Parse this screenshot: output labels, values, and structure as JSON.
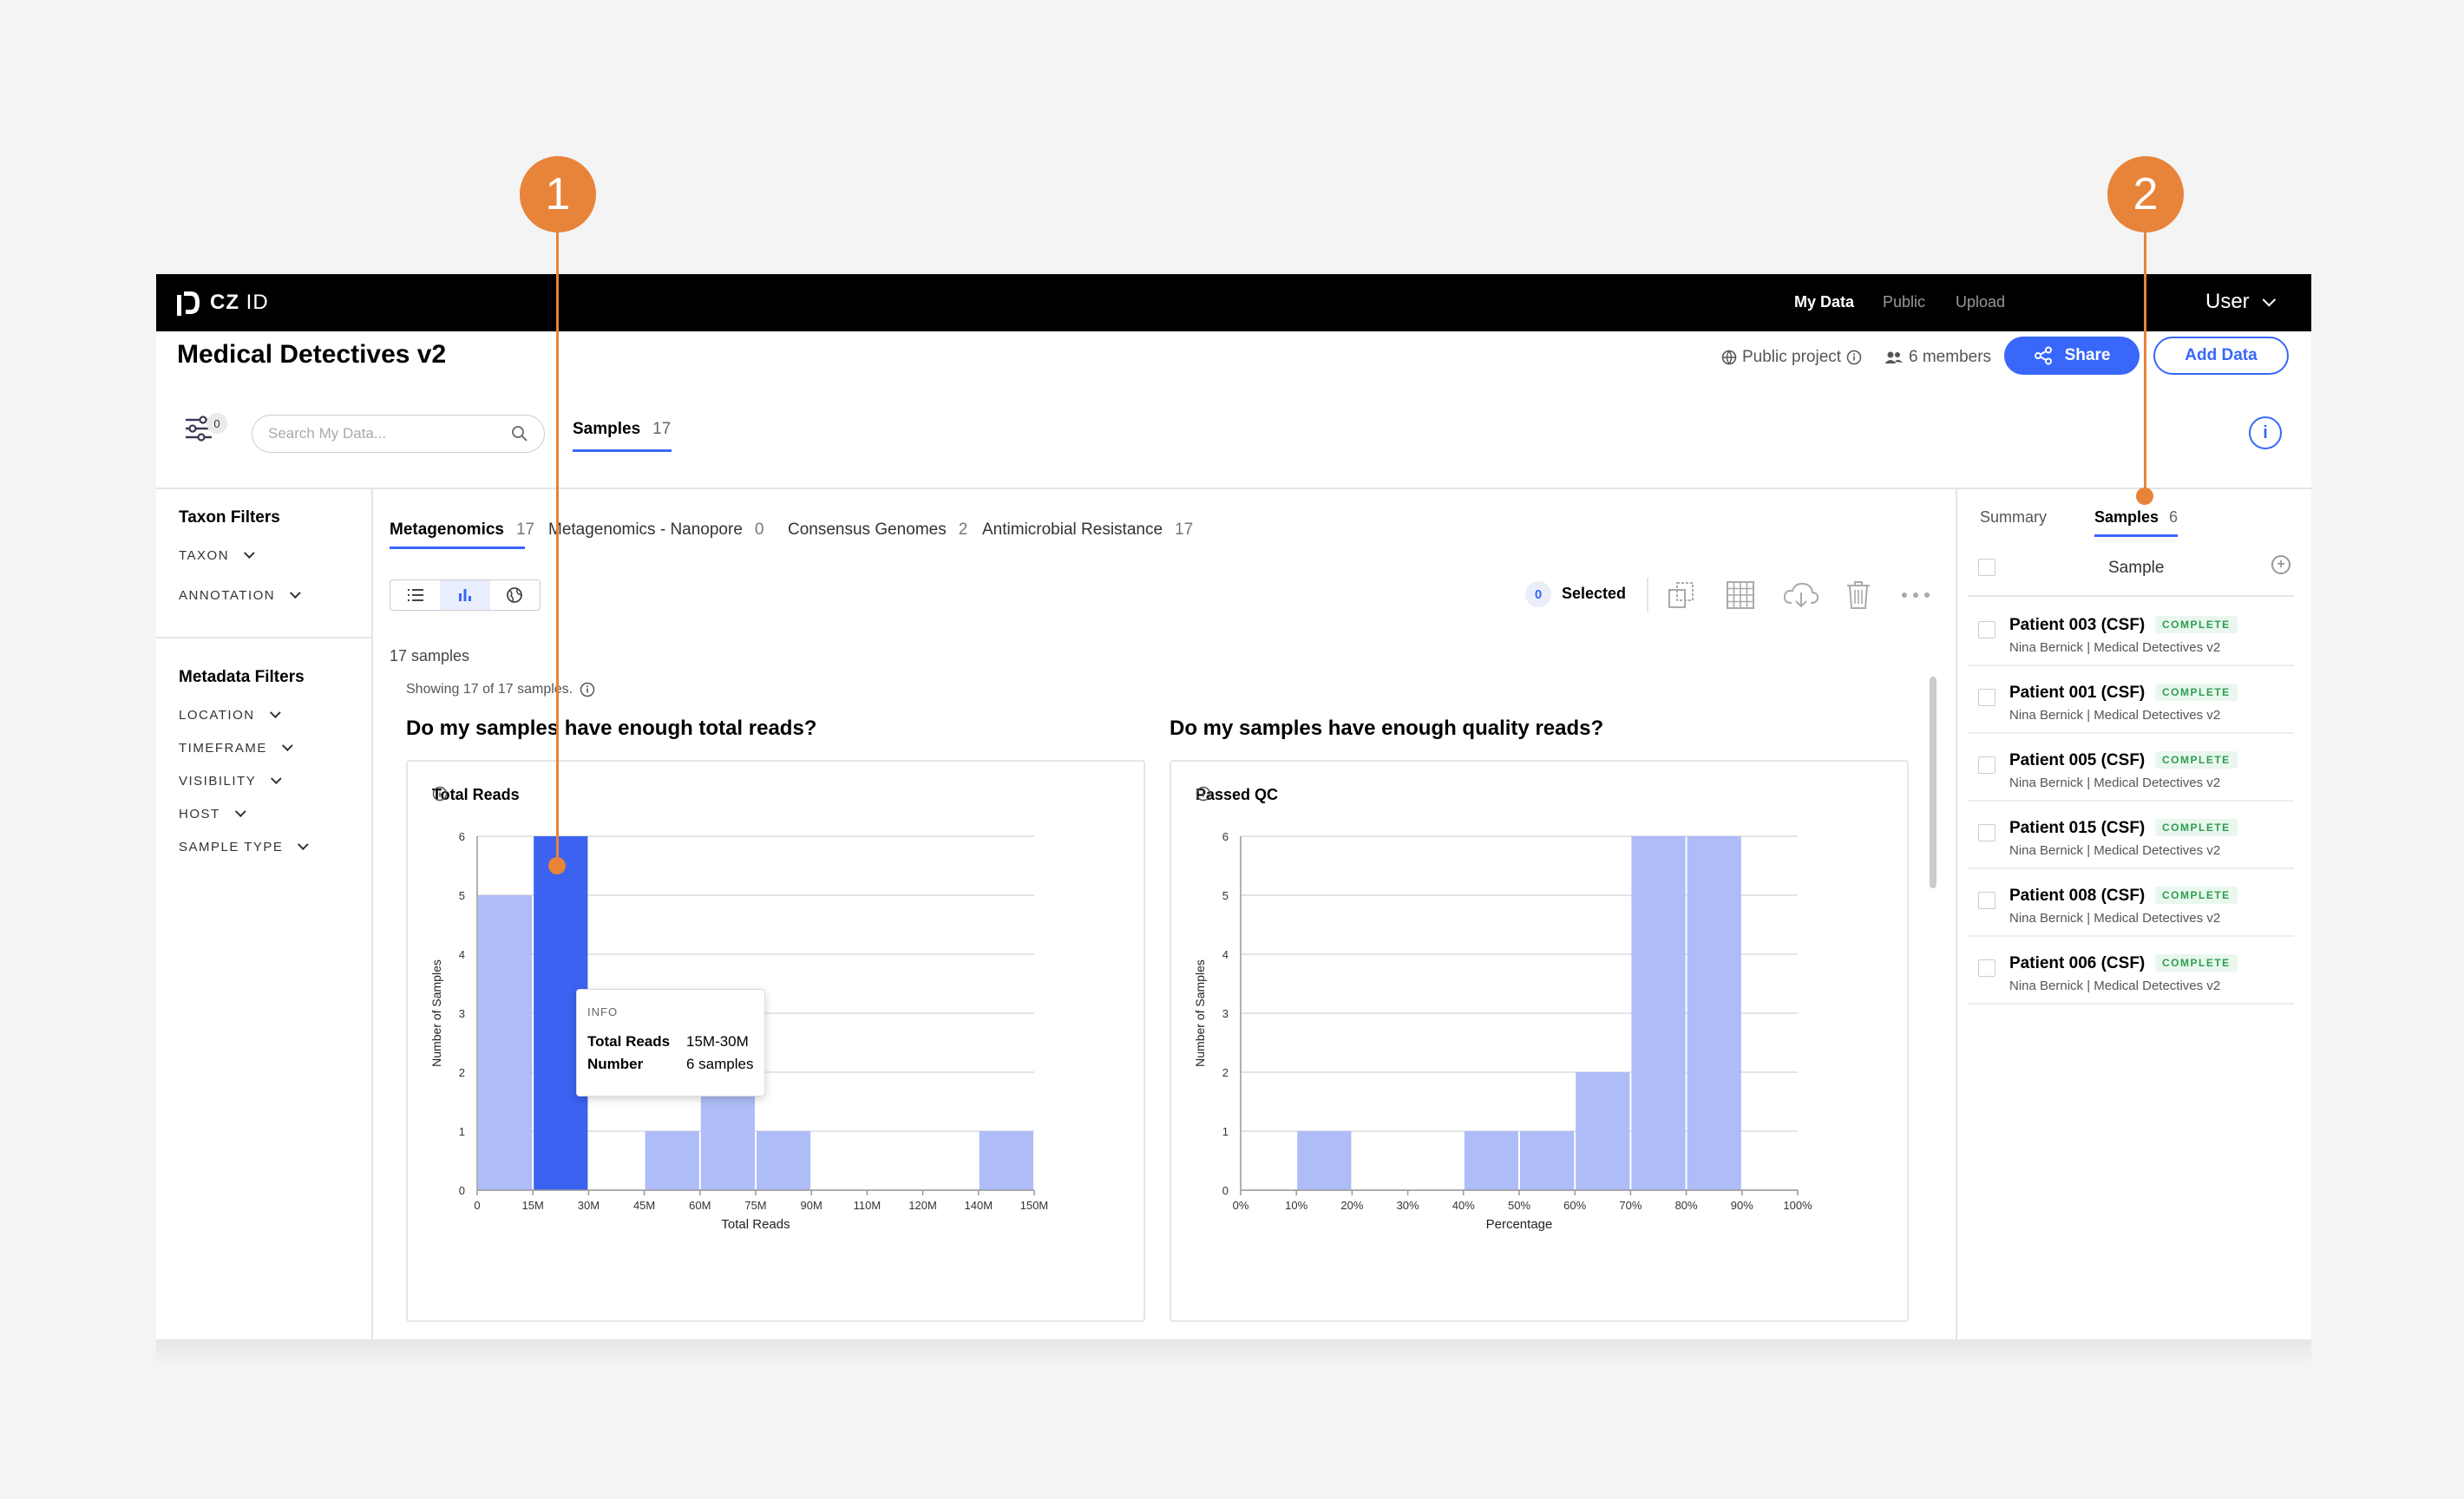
{
  "app": {
    "brand": "CZ",
    "brand_suffix": "ID",
    "nav": [
      "My Data",
      "Public",
      "Upload"
    ],
    "user": "User"
  },
  "project": {
    "title": "Medical Detectives v2",
    "visibility": "Public project",
    "members": "6 members",
    "share_label": "Share",
    "add_data_label": "Add Data"
  },
  "toolbar": {
    "filter_count": "0",
    "search_placeholder": "Search My Data...",
    "tab_label": "Samples",
    "tab_count": "17"
  },
  "sidebar": {
    "taxon_heading": "Taxon Filters",
    "taxon_items": [
      "TAXON",
      "ANNOTATION"
    ],
    "metadata_heading": "Metadata Filters",
    "metadata_items": [
      "LOCATION",
      "TIMEFRAME",
      "VISIBILITY",
      "HOST",
      "SAMPLE TYPE"
    ]
  },
  "workflow_tabs": [
    {
      "label": "Metagenomics",
      "count": "17"
    },
    {
      "label": "Metagenomics - Nanopore",
      "count": "0"
    },
    {
      "label": "Consensus Genomes",
      "count": "2"
    },
    {
      "label": "Antimicrobial Resistance",
      "count": "17"
    }
  ],
  "selection": {
    "count": "0",
    "label": "Selected"
  },
  "summary": {
    "samples_text": "17 samples",
    "showing_text": "Showing 17 of 17 samples."
  },
  "charts": {
    "q1": "Do my samples have enough total reads?",
    "q2": "Do my samples have enough quality reads?",
    "card1_title": "Total Reads",
    "card2_title": "Passed QC"
  },
  "tooltip": {
    "header": "INFO",
    "row1_key": "Total Reads",
    "row1_val": "15M-30M",
    "row2_key": "Number",
    "row2_val": "6 samples"
  },
  "right_panel": {
    "tab_summary": "Summary",
    "tab_samples": "Samples",
    "tab_samples_count": "6",
    "column_header": "Sample",
    "samples": [
      {
        "name": "Patient 003 (CSF)",
        "status": "COMPLETE",
        "sub": "Nina Bernick | Medical Detectives v2"
      },
      {
        "name": "Patient 001 (CSF)",
        "status": "COMPLETE",
        "sub": "Nina Bernick | Medical Detectives v2"
      },
      {
        "name": "Patient 005 (CSF)",
        "status": "COMPLETE",
        "sub": "Nina Bernick | Medical Detectives v2"
      },
      {
        "name": "Patient 015 (CSF)",
        "status": "COMPLETE",
        "sub": "Nina Bernick | Medical Detectives v2"
      },
      {
        "name": "Patient 008 (CSF)",
        "status": "COMPLETE",
        "sub": "Nina Bernick | Medical Detectives v2"
      },
      {
        "name": "Patient 006 (CSF)",
        "status": "COMPLETE",
        "sub": "Nina Bernick | Medical Detectives v2"
      }
    ]
  },
  "callouts": [
    "1",
    "2"
  ],
  "colors": {
    "accent": "#3867fa",
    "bar": "#aebcf7",
    "bar_highlight": "#3b62f0",
    "callout": "#e8833a",
    "complete": "#2e9e4f"
  },
  "chart_data": [
    {
      "type": "bar",
      "title": "Total Reads",
      "xlabel": "Total Reads",
      "ylabel": "Number of Samples",
      "x_ticks": [
        "0",
        "15M",
        "30M",
        "45M",
        "60M",
        "75M",
        "90M",
        "110M",
        "120M",
        "140M",
        "150M"
      ],
      "bins": [
        [
          0,
          15
        ],
        [
          15,
          30
        ],
        [
          30,
          45
        ],
        [
          45,
          60
        ],
        [
          60,
          75
        ],
        [
          75,
          90
        ],
        [
          90,
          105
        ],
        [
          105,
          120
        ],
        [
          120,
          135
        ],
        [
          135,
          150
        ]
      ],
      "values": [
        5,
        6,
        0,
        1,
        2,
        1,
        0,
        0,
        0,
        1
      ],
      "highlight_index": 1,
      "ylim": [
        0,
        6
      ],
      "y_ticks": [
        0,
        1,
        2,
        3,
        4,
        5,
        6
      ]
    },
    {
      "type": "bar",
      "title": "Passed QC",
      "xlabel": "Percentage",
      "ylabel": "Number of Samples",
      "x_ticks": [
        "0%",
        "10%",
        "20%",
        "30%",
        "40%",
        "50%",
        "60%",
        "70%",
        "80%",
        "90%",
        "100%"
      ],
      "bins": [
        [
          0,
          10
        ],
        [
          10,
          20
        ],
        [
          20,
          30
        ],
        [
          30,
          40
        ],
        [
          40,
          50
        ],
        [
          50,
          60
        ],
        [
          60,
          70
        ],
        [
          70,
          80
        ],
        [
          80,
          90
        ],
        [
          90,
          100
        ]
      ],
      "values": [
        0,
        1,
        0,
        0,
        1,
        1,
        2,
        6,
        6,
        0
      ],
      "ylim": [
        0,
        6
      ],
      "y_ticks": [
        0,
        1,
        2,
        3,
        4,
        5,
        6
      ]
    }
  ]
}
